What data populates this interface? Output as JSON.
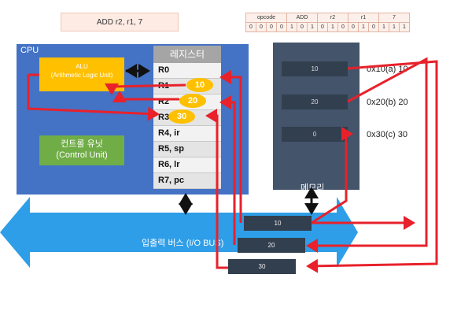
{
  "instruction": "ADD r2, r1, 7",
  "bit_table": {
    "headers": [
      "opcode",
      "ADD",
      "r2",
      "r1",
      "7"
    ],
    "bits": [
      "0",
      "0",
      "0",
      "0",
      "1",
      "0",
      "1",
      "0",
      "1",
      "0",
      "0",
      "1",
      "0",
      "1",
      "1",
      "1"
    ]
  },
  "cpu": {
    "label": "CPU",
    "alu": {
      "line1": "ALU",
      "line2": "(Arithmetic Logic Unit)"
    },
    "control_unit": {
      "line1": "컨트롤 유닛",
      "line2": "(Control Unit)"
    }
  },
  "registers": {
    "header": "레지스터",
    "items": [
      "R0",
      "R1",
      "R2",
      "R3",
      "R4, ir",
      "R5, sp",
      "R6, lr",
      "R7, pc"
    ],
    "ovals": [
      "10",
      "20",
      "30"
    ]
  },
  "memory": {
    "label": "메모리",
    "cells": [
      "10",
      "20",
      "0"
    ],
    "addresses": [
      "0x10(a) 10",
      "0x20(b) 20",
      "0x30(c) 30"
    ]
  },
  "bus": {
    "label": "입출력 버스 (I/O BUS)",
    "cells": [
      "10",
      "20",
      "30"
    ]
  },
  "colors": {
    "cpu": "#4472c4",
    "alu": "#ffc000",
    "control_unit": "#70ad47",
    "bus": "#2e9ee8",
    "arrow": "#e8212b"
  }
}
